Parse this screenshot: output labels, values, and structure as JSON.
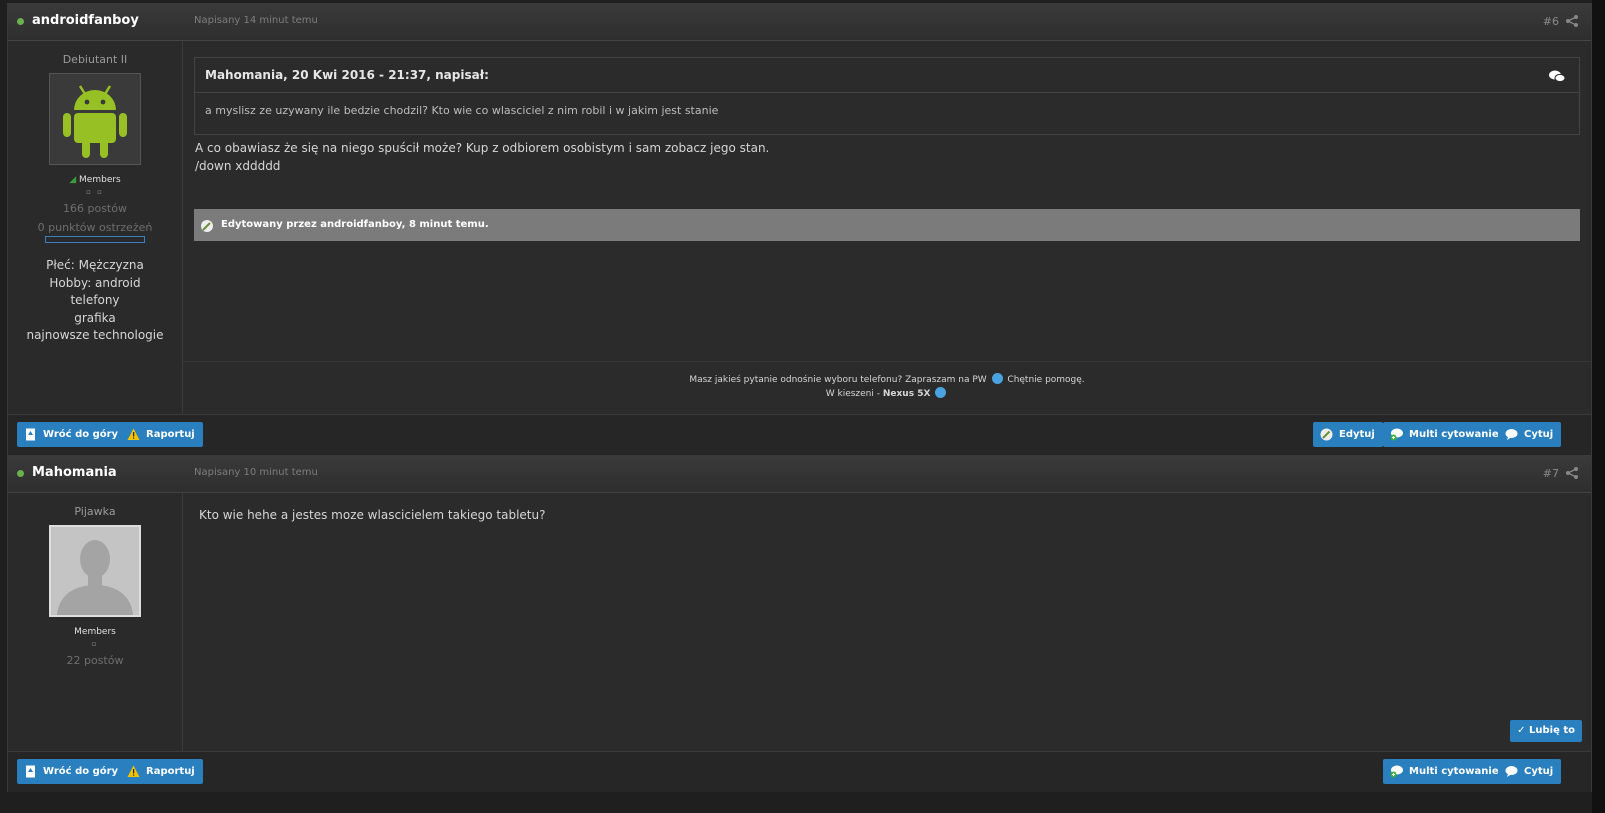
{
  "posts": [
    {
      "author": "androidfanboy",
      "date": "Napisany 14 minut temu",
      "number": "#6",
      "rank": "Debiutant II",
      "group": "Members",
      "pips": "▫ ▫",
      "posts_count": "166 postów",
      "warnings": "0 punktów ostrzeżeń",
      "profile": [
        "Płeć: Mężczyzna",
        "Hobby: android",
        "telefony",
        "grafika",
        "najnowsze technologie"
      ],
      "quote": {
        "author": "Mahomania, 20 Kwi 2016 - 21:37, napisał:",
        "text": "a myslisz ze uzywany ile bedzie chodzil? Kto wie co wlasciciel z nim robil i w jakim jest stanie"
      },
      "text_lines": [
        "A co obawiasz że się na niego spuścił może? Kup z odbiorem osobistym i sam zobacz jego stan.",
        "/down xddddd"
      ],
      "edited": "Edytowany przez androidfanboy, 8 minut temu.",
      "signature": {
        "line1_a": "Masz jakieś pytanie odnośnie wyboru telefonu? Zapraszam na PW",
        "line1_b": "Chętnie pomogę.",
        "line2_a": "W kieszeni - ",
        "line2_b": "Nexus 5X"
      },
      "footer": {
        "back_to_top": "Wróć do góry",
        "report": "Raportuj",
        "edit": "Edytuj",
        "multiquote": "Multi cytowanie",
        "quote": "Cytuj"
      }
    },
    {
      "author": "Mahomania",
      "date": "Napisany 10 minut temu",
      "number": "#7",
      "rank": "Pijawka",
      "group": "Members",
      "pips": "▫",
      "posts_count": "22 postów",
      "text": "Kto wie hehe a jestes moze wlascicielem takiego tabletu?",
      "like": "✓ Lubię to",
      "footer": {
        "back_to_top": "Wróć do góry",
        "report": "Raportuj",
        "multiquote": "Multi cytowanie",
        "quote": "Cytuj"
      }
    }
  ],
  "colors": {
    "button": "#2a7fbf",
    "online": "#6ab04c",
    "edit_bar": "#7b7b7b"
  }
}
